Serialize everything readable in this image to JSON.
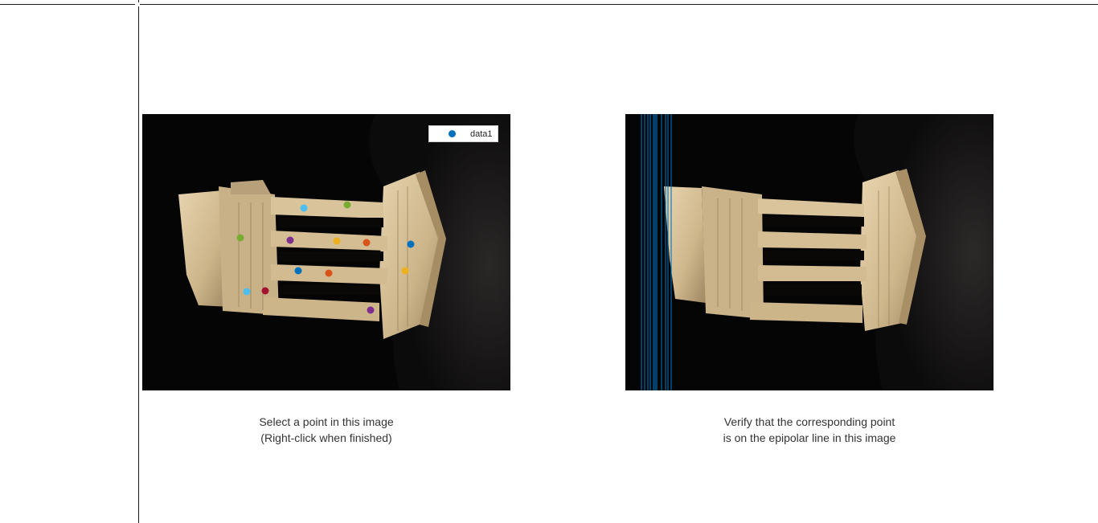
{
  "left_view": {
    "legend_label": "data1",
    "caption_line1": "Select a point in this image",
    "caption_line2": "(Right-click when finished)",
    "points": [
      {
        "color": "#4dbeee"
      },
      {
        "color": "#77ac30"
      },
      {
        "color": "#77ac30"
      },
      {
        "color": "#7e2f8e"
      },
      {
        "color": "#edb120"
      },
      {
        "color": "#d95319"
      },
      {
        "color": "#0072bd"
      },
      {
        "color": "#0072bd"
      },
      {
        "color": "#d95319"
      },
      {
        "color": "#edb120"
      },
      {
        "color": "#4dbeee"
      },
      {
        "color": "#a2142f"
      },
      {
        "color": "#7e2f8e"
      }
    ]
  },
  "right_view": {
    "caption_line1": "Verify that the corresponding point",
    "caption_line2": "is on the epipolar line in this image",
    "epipolar_line_color": "#0072bd"
  },
  "colors": {
    "background": "#ffffff",
    "image_background": "#050505",
    "sculpture": "#d9c29a"
  }
}
